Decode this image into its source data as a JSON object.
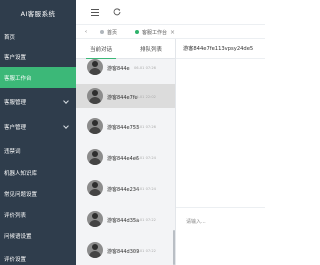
{
  "app": {
    "title": "AI客服系统"
  },
  "sidebar": {
    "items": [
      {
        "label": "首页",
        "has_submenu": false,
        "active": false
      },
      {
        "label": "客户设置",
        "has_submenu": false,
        "active": false
      },
      {
        "label": "客服工作台",
        "has_submenu": false,
        "active": true
      },
      {
        "label": "客服管理",
        "has_submenu": true,
        "active": false
      },
      {
        "label": "客户管理",
        "has_submenu": true,
        "active": false
      },
      {
        "label": "违禁词",
        "has_submenu": false,
        "active": false
      },
      {
        "label": "机器人知识库",
        "has_submenu": false,
        "active": false
      },
      {
        "label": "常见问题设置",
        "has_submenu": false,
        "active": false
      },
      {
        "label": "评价列表",
        "has_submenu": false,
        "active": false
      },
      {
        "label": "问候语设置",
        "has_submenu": false,
        "active": false
      },
      {
        "label": "评价设置",
        "has_submenu": false,
        "active": false
      }
    ],
    "colors": {
      "background": "#2f3d4c",
      "active": "#3cb878"
    }
  },
  "topbar": {
    "menu_icon": "hamburger-icon",
    "refresh_icon": "refresh-icon"
  },
  "tabs": {
    "home_label": "首页",
    "workspace_label": "客服工作台",
    "close_glyph": "×"
  },
  "conversation_panel": {
    "tabs": [
      {
        "label": "当前对话",
        "active": true
      },
      {
        "label": "排队列表",
        "active": false
      }
    ],
    "items": [
      {
        "name": "游客844e",
        "time": "06-01 07:26",
        "active": false
      },
      {
        "name": "游客844e7fe",
        "time": "06-01 22:02",
        "active": true
      },
      {
        "name": "游客844e753",
        "time": "06-01 07:26",
        "active": false
      },
      {
        "name": "游客844e4e6",
        "time": "06-01 07:24",
        "active": false
      },
      {
        "name": "游客844e234",
        "time": "06-01 07:24",
        "active": false
      },
      {
        "name": "游客844d35a",
        "time": "06-01 07:22",
        "active": false
      },
      {
        "name": "游客844d309",
        "time": "06-01 07:22",
        "active": false
      }
    ]
  },
  "chat": {
    "title": "游客844e7fe113vpsy24de5",
    "input_placeholder": "请输入..."
  }
}
